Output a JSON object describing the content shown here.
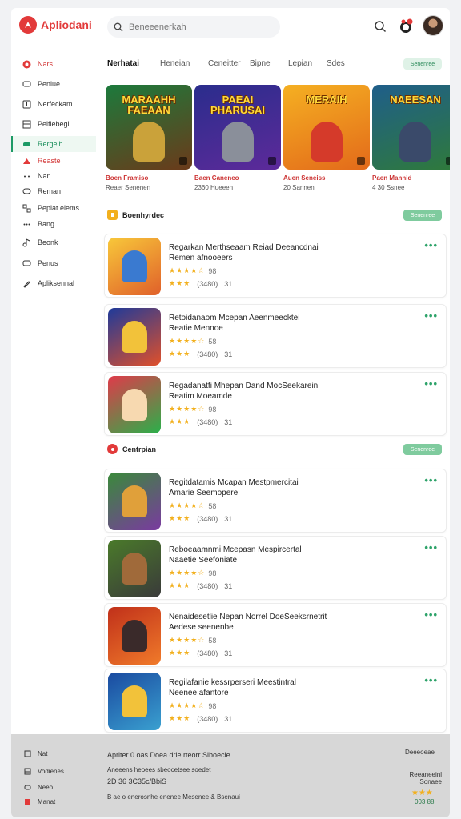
{
  "app": {
    "name": "Apliodani"
  },
  "search": {
    "placeholder": "Beneeenerkah"
  },
  "sidebar": {
    "items": [
      {
        "label": "Nars",
        "icon": "home-icon"
      },
      {
        "label": "Peniue",
        "icon": "chat-icon"
      },
      {
        "label": "Nerfeckam",
        "icon": "plus-icon"
      },
      {
        "label": "Peifiebegi",
        "icon": "image-icon"
      },
      {
        "label": "Rergeih",
        "icon": "gamepad-icon"
      },
      {
        "label": "Reaste",
        "icon": "apps-icon"
      },
      {
        "label": "Nan",
        "icon": "dots-icon"
      },
      {
        "label": "Reman",
        "icon": "chat-icon"
      },
      {
        "label": "Peplat elems",
        "icon": "grid-icon"
      },
      {
        "label": "Bang",
        "icon": "dots-icon"
      },
      {
        "label": "Beonk",
        "icon": "music-icon"
      },
      {
        "label": "Penus",
        "icon": "chat-icon"
      },
      {
        "label": "Apliksennal",
        "icon": "edit-icon"
      }
    ]
  },
  "tabs": [
    "Nerhatai",
    "Heneian",
    "Ceneitter",
    "Bipne",
    "Lepian",
    "Sdes"
  ],
  "tabs_pill": "Senenree",
  "featured": [
    {
      "banner": "MARAAHH FAEAAN",
      "title": "Boen Framiso",
      "sub": "Reaer Senenen",
      "colors": [
        "#1c7a3c",
        "#6b3a1a"
      ],
      "accent": "#caa23a"
    },
    {
      "banner": "PAEAI PHARUSAI",
      "title": "Baen Caneneo",
      "sub": "2360 Hueeen",
      "colors": [
        "#2a2d8c",
        "#5d2a9a"
      ],
      "accent": "#8a8f9a"
    },
    {
      "banner": "MERAIH",
      "title": "Auen Seneiss",
      "sub": "20 Sannen",
      "colors": [
        "#f5b022",
        "#e36a1a"
      ],
      "accent": "#d53a2a"
    },
    {
      "banner": "NAEESAN",
      "title": "Paen Mannid",
      "sub": "4 30 Ssnee",
      "colors": [
        "#1f5e8a",
        "#2f7a3a"
      ],
      "accent": "#3a4a6a"
    }
  ],
  "sections": [
    {
      "title": "Boenhyrdec",
      "pill": "Senenree",
      "icon_color": "#f2b01e"
    },
    {
      "title": "Centrpian",
      "pill": "Senenree",
      "icon_color": "#e23a3a"
    }
  ],
  "apps": [
    {
      "title": "Regarkan Merthseaam Reiad Deeancdnai",
      "subtitle": "Remen afnooeers",
      "rating_text": "98",
      "stats": "(3480)",
      "count": "31",
      "colors": [
        "#f8c83a",
        "#e0602a"
      ],
      "blob": "#3a7ad0"
    },
    {
      "title": "Retoidanaom Mcepan Aeenmeecktei",
      "subtitle": "Reatie Mennoe",
      "rating_text": "58",
      "stats": "(3480)",
      "count": "31",
      "colors": [
        "#1e3a9a",
        "#e0502a"
      ],
      "blob": "#f2c23a"
    },
    {
      "title": "Regadanatfi Mhepan Dand MocSeekarein",
      "subtitle": "Reatim Moeamde",
      "rating_text": "98",
      "stats": "(3480)",
      "count": "31",
      "colors": [
        "#e03a4a",
        "#2ab04a"
      ],
      "blob": "#f7d9b0"
    },
    {
      "title": "Regitdatamis Mcapan Mestpmercitai",
      "subtitle": "Amarie Seemopere",
      "rating_text": "58",
      "stats": "(3480)",
      "count": "31",
      "colors": [
        "#3a8a3a",
        "#7a3aa0"
      ],
      "blob": "#e0a03a"
    },
    {
      "title": "Reboeaamnmi Mcepasn Mespircertal",
      "subtitle": "Naaetie Seefoniate",
      "rating_text": "98",
      "stats": "(3480)",
      "count": "31",
      "colors": [
        "#4a7a2a",
        "#3a3a3a"
      ],
      "blob": "#a06a3a"
    },
    {
      "title": "Nenaidesetlie Nepan Norrel DoeSeeksrnetrit",
      "subtitle": "Aedese seenenbe",
      "rating_text": "58",
      "stats": "(3480)",
      "count": "31",
      "colors": [
        "#c0301a",
        "#f07a2a"
      ],
      "blob": "#3a2a2a"
    },
    {
      "title": "Regilafanie kessrperseri Meestintral",
      "subtitle": "Neenee afantore",
      "rating_text": "98",
      "stats": "(3480)",
      "count": "31",
      "colors": [
        "#1a4aa0",
        "#3aa0d0"
      ],
      "blob": "#f2c23a"
    }
  ],
  "footer": {
    "left_items": [
      "Nat",
      "Vodienes",
      "Neeo",
      "Manat"
    ],
    "line1": "Apriter 0 oas Doea drie rteorr Siboecie",
    "line2": "Aneeens heoees sbeocetsee soedet",
    "line3": "2D 36 3C35c/BbiS",
    "line4": "B ae o enerosnhe enenee Mesenee & Bsenaui",
    "right1": "Deeeoeae",
    "right2": "Reeaneeinl Sonaee",
    "right3": "003 88"
  },
  "colors": {
    "brand": "#e23a3a",
    "accent": "#2ea36a",
    "star": "#f2b01e"
  }
}
